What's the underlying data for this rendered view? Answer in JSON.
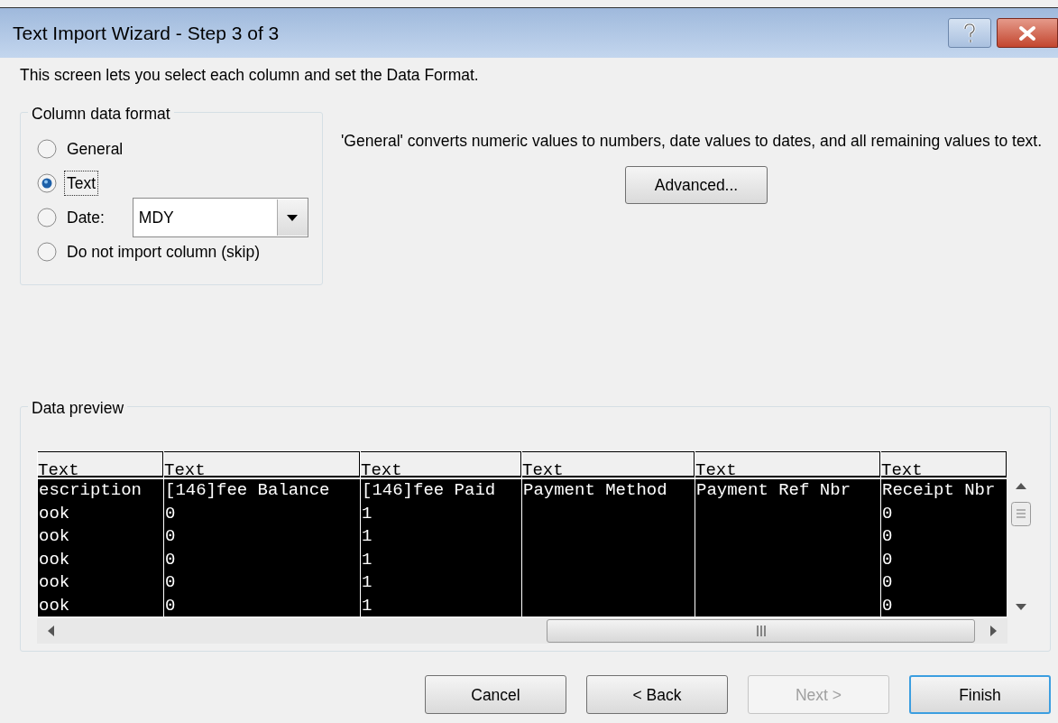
{
  "window": {
    "title": "Text Import Wizard - Step 3 of 3"
  },
  "instruction": "This screen lets you select each column and set the Data Format.",
  "column_data_format": {
    "title": "Column data format",
    "options": [
      {
        "kind": "radio",
        "label": "General",
        "selected": false
      },
      {
        "kind": "radio",
        "label": "Text",
        "selected": true
      },
      {
        "kind": "date",
        "label": "Date:",
        "selected": false,
        "value": "MDY"
      },
      {
        "kind": "radio",
        "label": "Do not import column (skip)",
        "selected": false
      }
    ]
  },
  "description": "'General' converts numeric values to numbers, date values to dates, and all remaining values to text.",
  "advanced_button": "Advanced...",
  "data_preview": {
    "title": "Data preview",
    "columns": [
      {
        "format": "Text",
        "selected": true,
        "cells": [
          "escription",
          "ook",
          "ook",
          "ook",
          "ook",
          "ook"
        ]
      },
      {
        "format": "Text",
        "selected": true,
        "cells": [
          "[146]fee Balance",
          "0",
          "0",
          "0",
          "0",
          "0"
        ]
      },
      {
        "format": "Text",
        "selected": true,
        "cells": [
          "[146]fee Paid",
          "1",
          "1",
          "1",
          "1",
          "1"
        ]
      },
      {
        "format": "Text",
        "selected": true,
        "cells": [
          "Payment Method",
          "",
          "",
          "",
          "",
          ""
        ]
      },
      {
        "format": "Text",
        "selected": true,
        "cells": [
          "Payment Ref Nbr",
          "",
          "",
          "",
          "",
          ""
        ]
      },
      {
        "format": "Text",
        "selected": true,
        "cells": [
          "Receipt Nbr",
          "0",
          "0",
          "0",
          "0",
          "0"
        ]
      }
    ]
  },
  "buttons": [
    {
      "label": "Cancel",
      "disabled": false,
      "default": false
    },
    {
      "label": "< Back",
      "disabled": false,
      "default": false
    },
    {
      "label": "Next >",
      "disabled": true,
      "default": false
    },
    {
      "label": "Finish",
      "disabled": false,
      "default": true
    }
  ]
}
